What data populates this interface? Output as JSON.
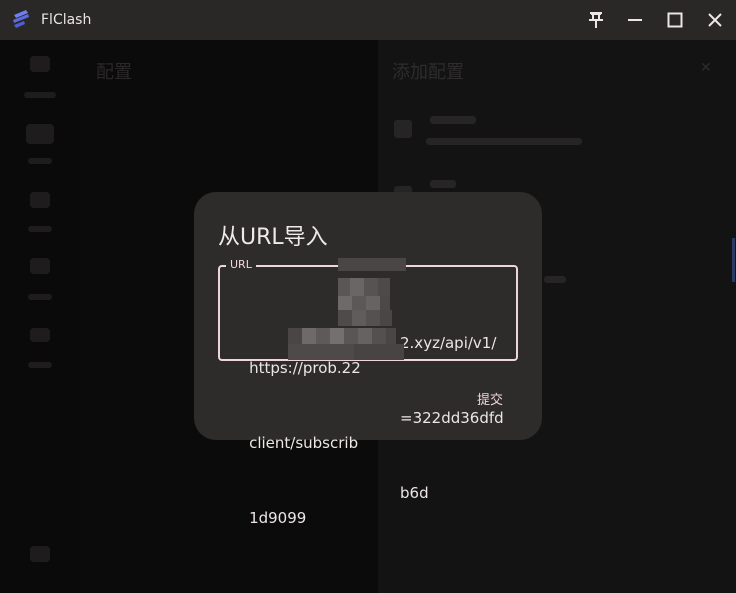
{
  "window": {
    "title": "FlClash"
  },
  "background": {
    "page_title": "配置",
    "panel_title": "添加配置",
    "panel_close_glyph": "✕"
  },
  "dialog": {
    "title": "从URL导入",
    "url_field": {
      "label": "URL",
      "value_lines": [
        "https://prob.22",
        "client/subscrib",
        "1d9099"
      ],
      "value_tail_lines": [
        "2.xyz/api/v1/",
        "=322dd36dfd",
        "b6d"
      ]
    },
    "submit_label": "提交"
  },
  "colors": {
    "accent": "#f1d6d8",
    "dialog_bg": "#2e2b2b",
    "titlebar_bg": "#2a2727"
  }
}
